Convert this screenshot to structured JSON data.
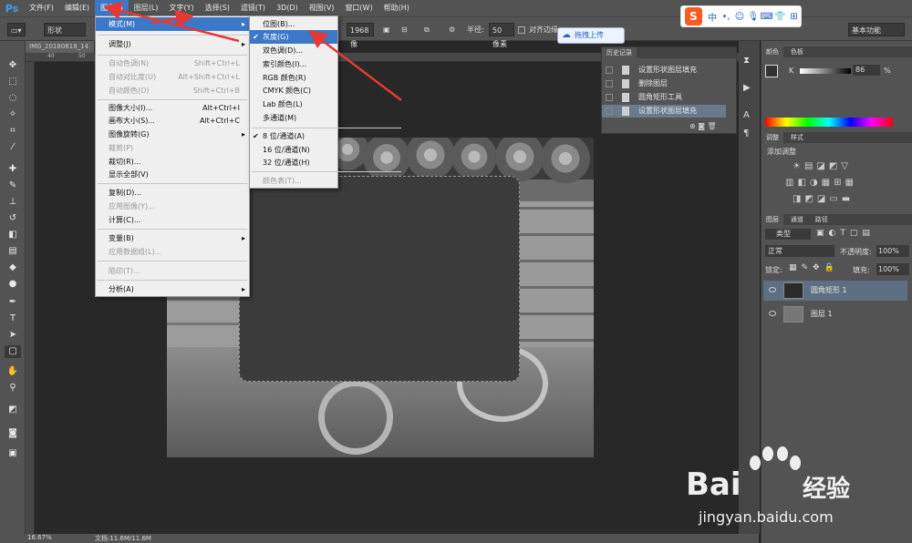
{
  "app": {
    "logo": "Ps"
  },
  "menubar": {
    "items": [
      "文件(F)",
      "编辑(E)",
      "图像(I)",
      "图层(L)",
      "文字(Y)",
      "选择(S)",
      "滤镜(T)",
      "3D(D)",
      "视图(V)",
      "窗口(W)",
      "帮助(H)"
    ]
  },
  "options": {
    "shape_mode": "形状",
    "width_value": "1968 像",
    "radius_label": "半径:",
    "radius_value": "50 像素",
    "align_edges": "对齐边缘",
    "workspace": "基本功能"
  },
  "document": {
    "tab_title": "IMG_20180818_14",
    "ruler_ticks": [
      "40",
      "50"
    ],
    "zoom": "16.67%",
    "doc_info": "文档:11.6M/11.6M"
  },
  "image_menu": {
    "items": [
      {
        "label": "模式(M)",
        "submenu": true,
        "highlight": true
      },
      {
        "label": "调整(J)",
        "submenu": true
      },
      {
        "label": "自动色调(N)",
        "shortcut": "Shift+Ctrl+L",
        "disabled": true
      },
      {
        "label": "自动对比度(U)",
        "shortcut": "Alt+Shift+Ctrl+L",
        "disabled": true
      },
      {
        "label": "自动颜色(O)",
        "shortcut": "Shift+Ctrl+B",
        "disabled": true
      },
      {
        "label": "图像大小(I)...",
        "shortcut": "Alt+Ctrl+I"
      },
      {
        "label": "画布大小(S)...",
        "shortcut": "Alt+Ctrl+C"
      },
      {
        "label": "图像旋转(G)",
        "submenu": true
      },
      {
        "label": "裁剪(P)",
        "disabled": true
      },
      {
        "label": "裁切(R)..."
      },
      {
        "label": "显示全部(V)"
      },
      {
        "label": "复制(D)..."
      },
      {
        "label": "应用图像(Y)...",
        "disabled": true
      },
      {
        "label": "计算(C)..."
      },
      {
        "label": "变量(B)",
        "submenu": true
      },
      {
        "label": "应用数据组(L)...",
        "disabled": true
      },
      {
        "label": "陷印(T)...",
        "disabled": true
      },
      {
        "label": "分析(A)",
        "submenu": true
      }
    ]
  },
  "mode_menu": {
    "items": [
      {
        "label": "位图(B)..."
      },
      {
        "label": "灰度(G)",
        "checked": true,
        "highlight": true
      },
      {
        "label": "双色调(D)..."
      },
      {
        "label": "索引颜色(I)..."
      },
      {
        "label": "RGB 颜色(R)"
      },
      {
        "label": "CMYK 颜色(C)"
      },
      {
        "label": "Lab 颜色(L)"
      },
      {
        "label": "多通道(M)"
      },
      {
        "label": "8 位/通道(A)",
        "checked": true
      },
      {
        "label": "16 位/通道(N)"
      },
      {
        "label": "32 位/通道(H)"
      },
      {
        "label": "颜色表(T)...",
        "disabled": true
      }
    ]
  },
  "history": {
    "tab": "历史记录",
    "rows": [
      "设置形状图层填充",
      "删除图层",
      "圆角矩形工具",
      "设置形状图层填充"
    ]
  },
  "color_panel": {
    "tabs": [
      "颜色",
      "色板"
    ],
    "channel": "K",
    "value": "86",
    "unit": "%"
  },
  "adjust_panel": {
    "tabs": [
      "调整",
      "样式"
    ],
    "title": "添加调整"
  },
  "layers_panel": {
    "tabs": [
      "图层",
      "通道",
      "路径"
    ],
    "kind": "类型",
    "blend": "正常",
    "opacity_label": "不透明度:",
    "opacity": "100%",
    "lock_label": "锁定:",
    "fill_label": "填充:",
    "fill": "100%",
    "layers": [
      "圆角矩形 1",
      "图层 1"
    ]
  },
  "overlay": {
    "drag_upload": "拖拽上传"
  },
  "ime": {
    "logo": "S",
    "lang": "中"
  },
  "watermark": {
    "brand": "Bai",
    "brand2": "经验",
    "url": "jingyan.baidu.com"
  },
  "colors": {
    "menu_highlight": "#3b78c8",
    "arrow": "#e53935"
  }
}
